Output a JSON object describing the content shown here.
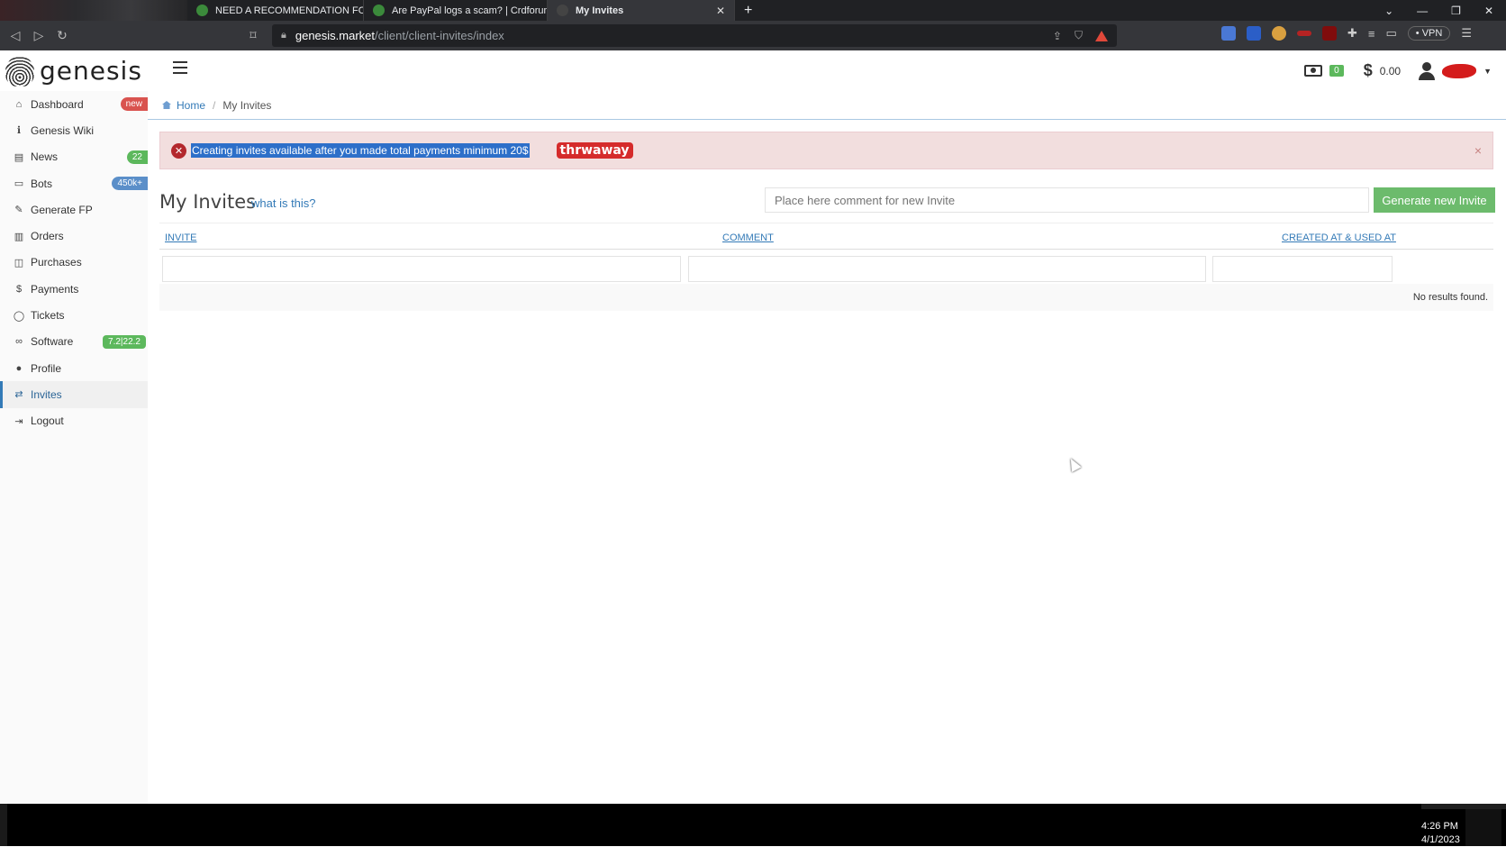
{
  "browser": {
    "tabs": [
      {
        "title": "NEED A RECOMMENDATION FOR A S|",
        "active": false
      },
      {
        "title": "Are PayPal logs a scam? | Crdforum | #",
        "active": false
      },
      {
        "title": "My Invites",
        "active": true
      }
    ],
    "new_tab_label": "+",
    "url_host": "genesis.market",
    "url_path": "/client/client-invites/index",
    "vpn_label": "• VPN"
  },
  "header": {
    "logo_text": "genesis",
    "cash_count": "0",
    "balance": "0.00",
    "dollar_symbol": "$"
  },
  "sidebar": {
    "items": [
      {
        "label": "Dashboard",
        "icon": "home-icon",
        "badge": "new"
      },
      {
        "label": "Genesis Wiki",
        "icon": "info-icon",
        "badge": ""
      },
      {
        "label": "News",
        "icon": "newspaper-icon",
        "badge": "22"
      },
      {
        "label": "Bots",
        "icon": "laptop-icon",
        "badge": "450k+"
      },
      {
        "label": "Generate FP",
        "icon": "magic-wand-icon",
        "badge": ""
      },
      {
        "label": "Orders",
        "icon": "basket-icon",
        "badge": ""
      },
      {
        "label": "Purchases",
        "icon": "cash-icon",
        "badge": ""
      },
      {
        "label": "Payments",
        "icon": "dollar-icon",
        "badge": ""
      },
      {
        "label": "Tickets",
        "icon": "chat-bubble-icon",
        "badge": ""
      },
      {
        "label": "Software",
        "icon": "mask-icon",
        "badge": "7.2|22.2"
      },
      {
        "label": "Profile",
        "icon": "user-icon",
        "badge": ""
      },
      {
        "label": "Invites",
        "icon": "retweet-icon",
        "badge": ""
      },
      {
        "label": "Logout",
        "icon": "sign-out-icon",
        "badge": ""
      }
    ]
  },
  "breadcrumb": {
    "home": "Home",
    "current": "My Invites"
  },
  "alert": {
    "message": "Creating invites available after you made total payments minimum 20$",
    "tag": "thrwaway",
    "close": "×"
  },
  "main": {
    "title": "My Invites",
    "what_link": "what is this?",
    "comment_placeholder": "Place here comment for new Invite",
    "generate_button": "Generate new Invite",
    "columns": [
      "INVITE",
      "COMMENT",
      "CREATED AT & USED AT"
    ],
    "empty_text": "No results found."
  },
  "taskbar": {
    "time": "4:26 PM",
    "date": "4/1/2023"
  },
  "colors": {
    "accent": "#337ab7",
    "success": "#6cbb6c",
    "danger_bg": "#f2dede",
    "badge_red": "#d9534f",
    "badge_green": "#5cb85c",
    "badge_blue": "#5b8fc9"
  }
}
